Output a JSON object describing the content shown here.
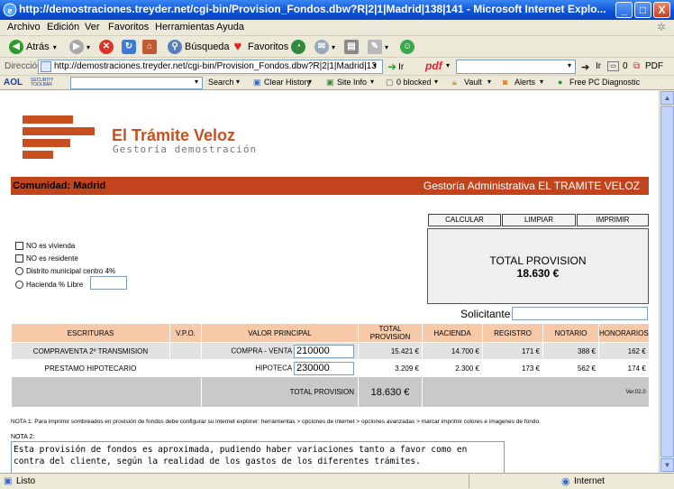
{
  "window": {
    "title": "http://demostraciones.treyder.net/cgi-bin/Provision_Fondos.dbw?R|2|1|Madrid|138|141 - Microsoft Internet Explo...",
    "min": "_",
    "max": "□",
    "close": "X"
  },
  "menu": [
    "Archivo",
    "Edición",
    "Ver",
    "Favoritos",
    "Herramientas",
    "Ayuda"
  ],
  "toolbar": {
    "back": "Atrás",
    "search": "Búsqueda",
    "favorites": "Favoritos"
  },
  "address": {
    "label": "Dirección",
    "url": "http://demostraciones.treyder.net/cgi-bin/Provision_Fondos.dbw?R|2|1|Madrid|13",
    "go": "Ir",
    "pdf": "pdf",
    "ir2": "Ir",
    "zero": "0",
    "pdf2": "PDF"
  },
  "aol": {
    "brand": "AOL",
    "security": "SECURITY TOOLBAR",
    "search": "Search",
    "clear_history": "Clear History",
    "site_info": "Site Info",
    "blocked": "0 blocked",
    "vault": "Vault",
    "alerts": "Alerts",
    "free_pc": "Free PC Diagnostic"
  },
  "page": {
    "logo_title": "El Trámite Veloz",
    "logo_sub": "Gestoría demostración",
    "comunidad": "Comunidad: Madrid",
    "gestoria": "Gestoría Administrativa EL TRAMITE VELOZ",
    "btn_calcular": "CALCULAR",
    "btn_limpiar": "LIMPIAR",
    "btn_imprimir": "IMPRIMIR",
    "total_label": "TOTAL PROVISION",
    "total_value": "18.630 €",
    "opt_vivienda": "NO es vivienda",
    "opt_residente": "NO es residente",
    "opt_distrito": "Distrito municipal centro 4%",
    "opt_hacienda": "Hacienda % Libre",
    "solicitante": "Solicitante",
    "table": {
      "headers": [
        "ESCRITURAS",
        "V.P.O.",
        "VALOR PRINCIPAL",
        "TOTAL PROVISION",
        "HACIENDA",
        "REGISTRO",
        "NOTARIO",
        "HONORARIOS"
      ],
      "rows": [
        {
          "escritura": "COMPRAVENTA 2º TRANSMISION",
          "tipo": "COMPRA - VENTA",
          "valor": "210000",
          "total": "15.421 €",
          "hacienda": "14.700 €",
          "registro": "171 €",
          "notario": "388 €",
          "honorarios": "162 €"
        },
        {
          "escritura": "PRESTAMO HIPOTECARIO",
          "tipo": "HIPOTECA",
          "valor": "230000",
          "total": "3.209 €",
          "hacienda": "2.300 €",
          "registro": "173 €",
          "notario": "562 €",
          "honorarios": "174 €"
        }
      ],
      "footer_label": "TOTAL PROVISION",
      "footer_value": "18.630 €",
      "version": "Ver.02.0"
    },
    "nota1": "NOTA 1: Para imprimir sombreados en provisión de fondos debe configurar su internet explorer: herramientas > opciones de internet > opciones avanzadas > marcar imprimir colores e imagenes de fondo.",
    "nota2_label": "NOTA 2:",
    "nota2_text": "Esta provisión de fondos es aproximada, pudiendo haber variaciones tanto a favor como en contra del cliente, según la realidad de los gastos de los diferentes trámites."
  },
  "status": {
    "left": "Listo",
    "right": "Internet"
  }
}
